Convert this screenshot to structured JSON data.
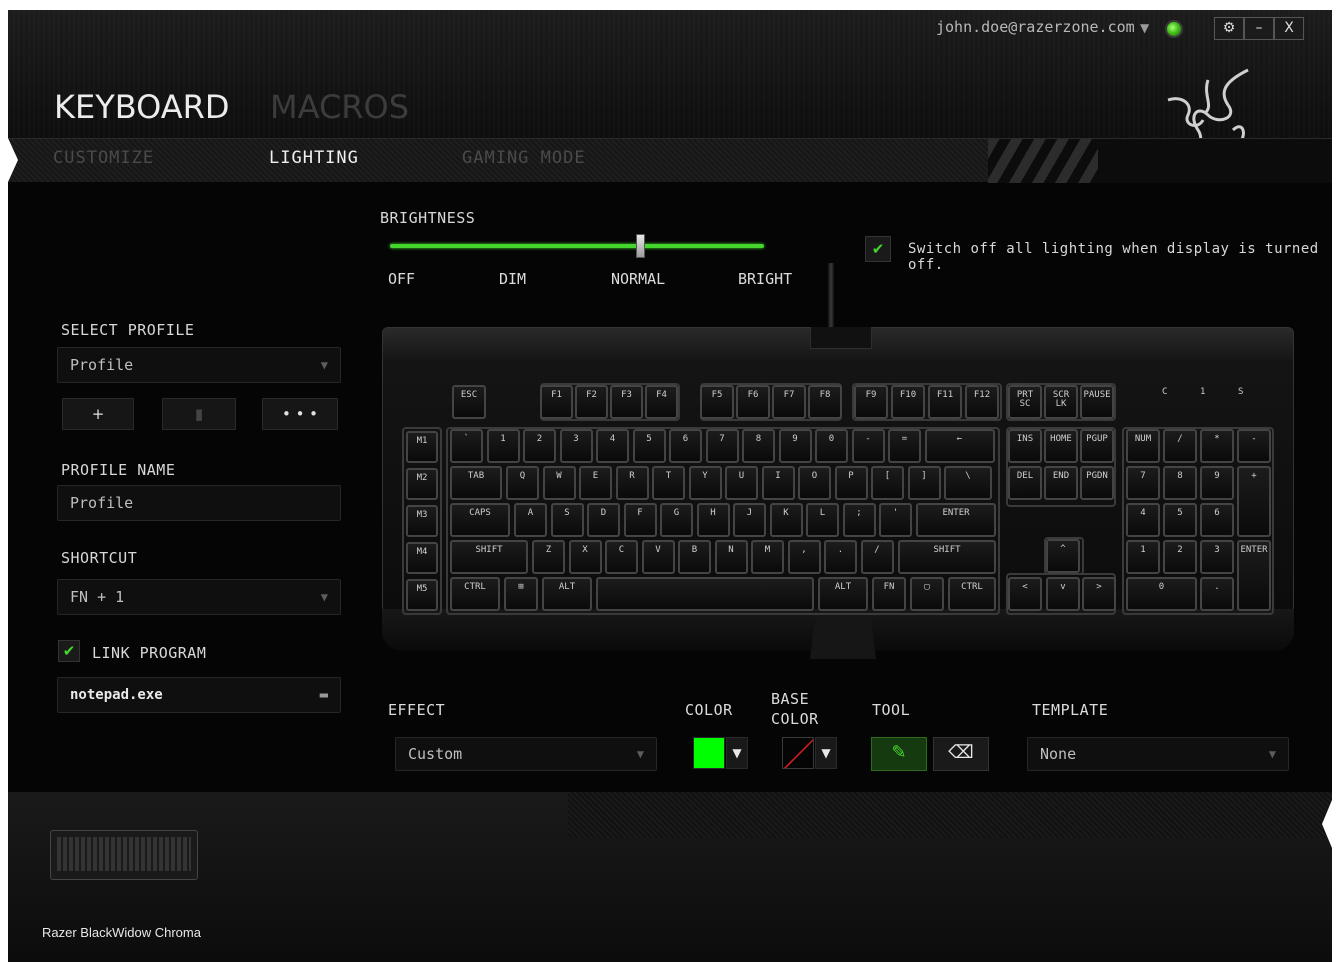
{
  "header": {
    "account_email": "john.doe@razerzone.com",
    "account_dropdown_icon": "chevron-down-icon",
    "status_icon": "online-status-icon",
    "window_buttons": [
      {
        "name": "settings-button",
        "glyph": "⚙"
      },
      {
        "name": "minimize-button",
        "glyph": "–"
      },
      {
        "name": "close-button",
        "glyph": "X"
      }
    ],
    "main_tabs": [
      {
        "label": "KEYBOARD",
        "active": true
      },
      {
        "label": "MACROS",
        "active": false
      }
    ],
    "sub_tabs": [
      {
        "label": "CUSTOMIZE",
        "active": false
      },
      {
        "label": "LIGHTING",
        "active": true
      },
      {
        "label": "GAMING MODE",
        "active": false
      }
    ],
    "logo_icon": "razer-snake-logo-icon"
  },
  "sidebar": {
    "select_profile_label": "SELECT PROFILE",
    "profile_value": "Profile",
    "profile_buttons": [
      {
        "name": "add-profile-button",
        "glyph": "+"
      },
      {
        "name": "delete-profile-button",
        "glyph": "🗑"
      },
      {
        "name": "more-profile-button",
        "glyph": "• • •"
      }
    ],
    "profile_name_label": "PROFILE NAME",
    "profile_name_value": "Profile",
    "shortcut_label": "SHORTCUT",
    "shortcut_value": "FN + 1",
    "link_program_label": "LINK PROGRAM",
    "link_program_checked": true,
    "program_value": "notepad.exe",
    "folder_icon": "folder-icon"
  },
  "brightness": {
    "label": "BRIGHTNESS",
    "levels": [
      "OFF",
      "DIM",
      "NORMAL",
      "BRIGHT"
    ],
    "value_fraction": 0.67,
    "switch_off_label": "Switch off all lighting when display is turned off.",
    "switch_off_checked": true,
    "accent_color": "#44d62c"
  },
  "keyboard": {
    "macro_keys": [
      "M1",
      "M2",
      "M3",
      "M4",
      "M5"
    ],
    "row_fn": [
      "ESC",
      "F1",
      "F2",
      "F3",
      "F4",
      "F5",
      "F6",
      "F7",
      "F8",
      "F9",
      "F10",
      "F11",
      "F12",
      "PRT SC",
      "SCR LK",
      "PAUSE"
    ],
    "row_num": [
      "`",
      "1",
      "2",
      "3",
      "4",
      "5",
      "6",
      "7",
      "8",
      "9",
      "0",
      "-",
      "=",
      "←"
    ],
    "row_tab": [
      "TAB",
      "Q",
      "W",
      "E",
      "R",
      "T",
      "Y",
      "U",
      "I",
      "O",
      "P",
      "[",
      "]",
      "\\"
    ],
    "row_caps": [
      "CAPS",
      "A",
      "S",
      "D",
      "F",
      "G",
      "H",
      "J",
      "K",
      "L",
      ";",
      "'",
      "ENTER"
    ],
    "row_shift": [
      "SHIFT",
      "Z",
      "X",
      "C",
      "V",
      "B",
      "N",
      "M",
      ",",
      ".",
      "/",
      "SHIFT"
    ],
    "row_ctrl": [
      "CTRL",
      "⊞",
      "ALT",
      "",
      "ALT",
      "FN",
      "▢",
      "CTRL"
    ],
    "nav_top": [
      "INS",
      "HOME",
      "PGUP"
    ],
    "nav_mid": [
      "DEL",
      "END",
      "PGDN"
    ],
    "arrows": [
      "^",
      "<",
      "v",
      ">"
    ],
    "numpad": [
      "NUM",
      "/",
      "*",
      "-",
      "7",
      "8",
      "9",
      "+",
      "4",
      "5",
      "6",
      "1",
      "2",
      "3",
      "ENTER",
      "0",
      "."
    ],
    "indicators": [
      "C",
      "1",
      "S"
    ]
  },
  "controls": {
    "effect_label": "EFFECT",
    "effect_value": "Custom",
    "color_label": "COLOR",
    "color_value": "#00ff00",
    "base_color_label": "BASE\nCOLOR",
    "base_color_value": "none",
    "tool_label": "TOOL",
    "tool_icons": [
      "pencil-icon",
      "eraser-icon"
    ],
    "template_label": "TEMPLATE",
    "template_value": "None"
  },
  "footer": {
    "device_name": "Razer BlackWidow Chroma"
  }
}
